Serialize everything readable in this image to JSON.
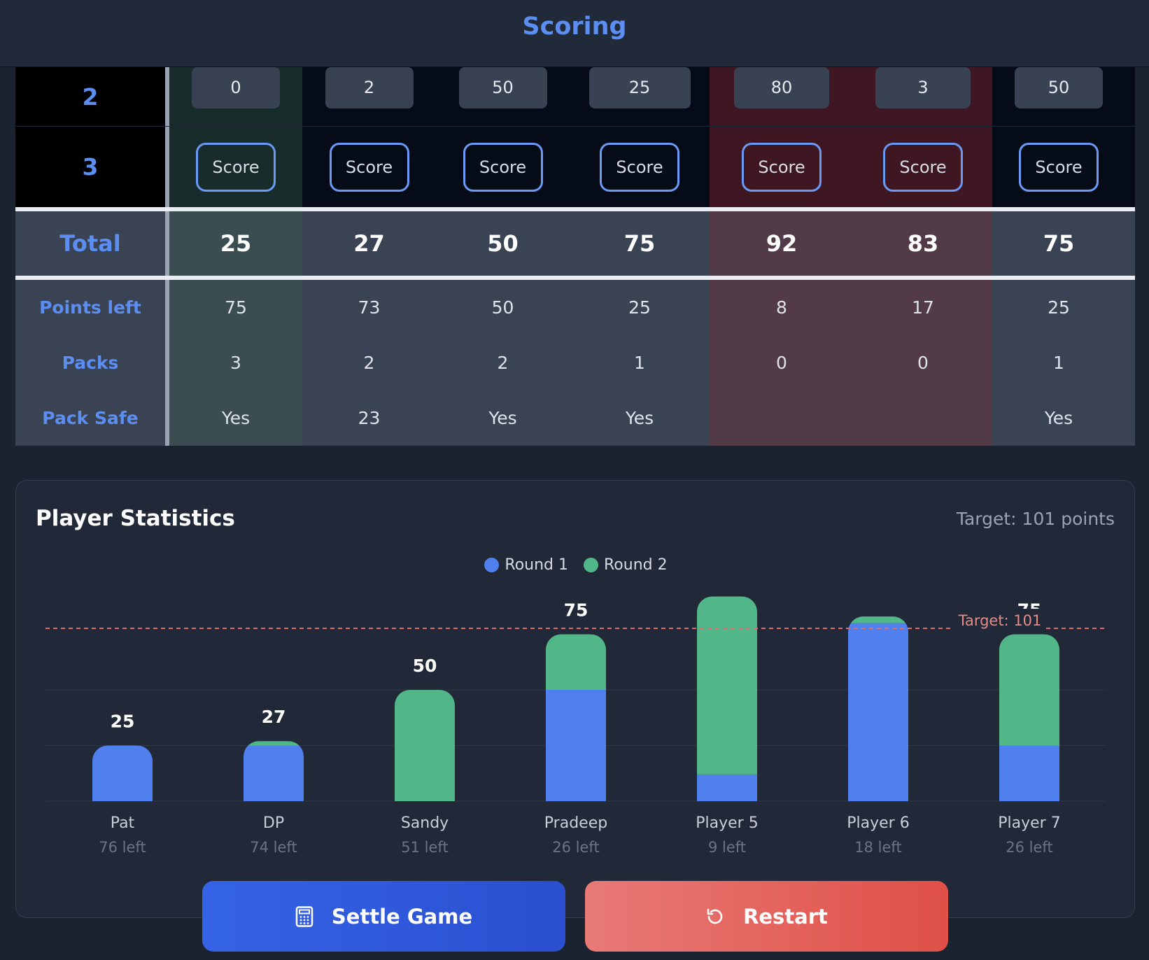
{
  "header": {
    "title": "Scoring"
  },
  "table": {
    "columns": [
      {
        "highlight": "green"
      },
      {
        "highlight": "none"
      },
      {
        "highlight": "none"
      },
      {
        "highlight": "none"
      },
      {
        "highlight": "red"
      },
      {
        "highlight": "red"
      },
      {
        "highlight": "none"
      }
    ],
    "round2": {
      "label": "2",
      "values": [
        "0",
        "2",
        "50",
        "25",
        "80",
        "3",
        "50"
      ]
    },
    "round3": {
      "label": "3",
      "button_label": "Score"
    },
    "total": {
      "label": "Total",
      "values": [
        "25",
        "27",
        "50",
        "75",
        "92",
        "83",
        "75"
      ]
    },
    "points_left": {
      "label": "Points left",
      "values": [
        "75",
        "73",
        "50",
        "25",
        "8",
        "17",
        "25"
      ]
    },
    "packs": {
      "label": "Packs",
      "values": [
        "3",
        "2",
        "2",
        "1",
        "0",
        "0",
        "1"
      ]
    },
    "pack_safe": {
      "label": "Pack Safe",
      "values": [
        "Yes",
        "23",
        "Yes",
        "Yes",
        "",
        "",
        "Yes"
      ]
    }
  },
  "stats": {
    "title": "Player Statistics",
    "target_text": "Target: 101 points"
  },
  "chart_data": {
    "type": "bar",
    "stacked": true,
    "categories": [
      "Pat",
      "DP",
      "Sandy",
      "Pradeep",
      "Player 5",
      "Player 6",
      "Player 7"
    ],
    "sublabels": [
      "76 left",
      "74 left",
      "51 left",
      "26 left",
      "9 left",
      "18 left",
      "26 left"
    ],
    "series": [
      {
        "name": "Round 1",
        "color": "#4f80ee",
        "values": [
          25,
          25,
          0,
          50,
          12,
          80,
          25
        ]
      },
      {
        "name": "Round 2",
        "color": "#52b788",
        "values": [
          0,
          2,
          50,
          25,
          80,
          3,
          50
        ]
      }
    ],
    "totals": [
      "25",
      "27",
      "50",
      "75",
      "92",
      "83",
      "75"
    ],
    "ylim": [
      0,
      101
    ],
    "target": 101,
    "target_label": "Target: 101",
    "grid": true,
    "legend": "top-center"
  },
  "actions": {
    "settle_label": "Settle Game",
    "restart_label": "Restart"
  },
  "icons": {
    "settle": "calculator-icon",
    "restart": "restart-icon"
  }
}
